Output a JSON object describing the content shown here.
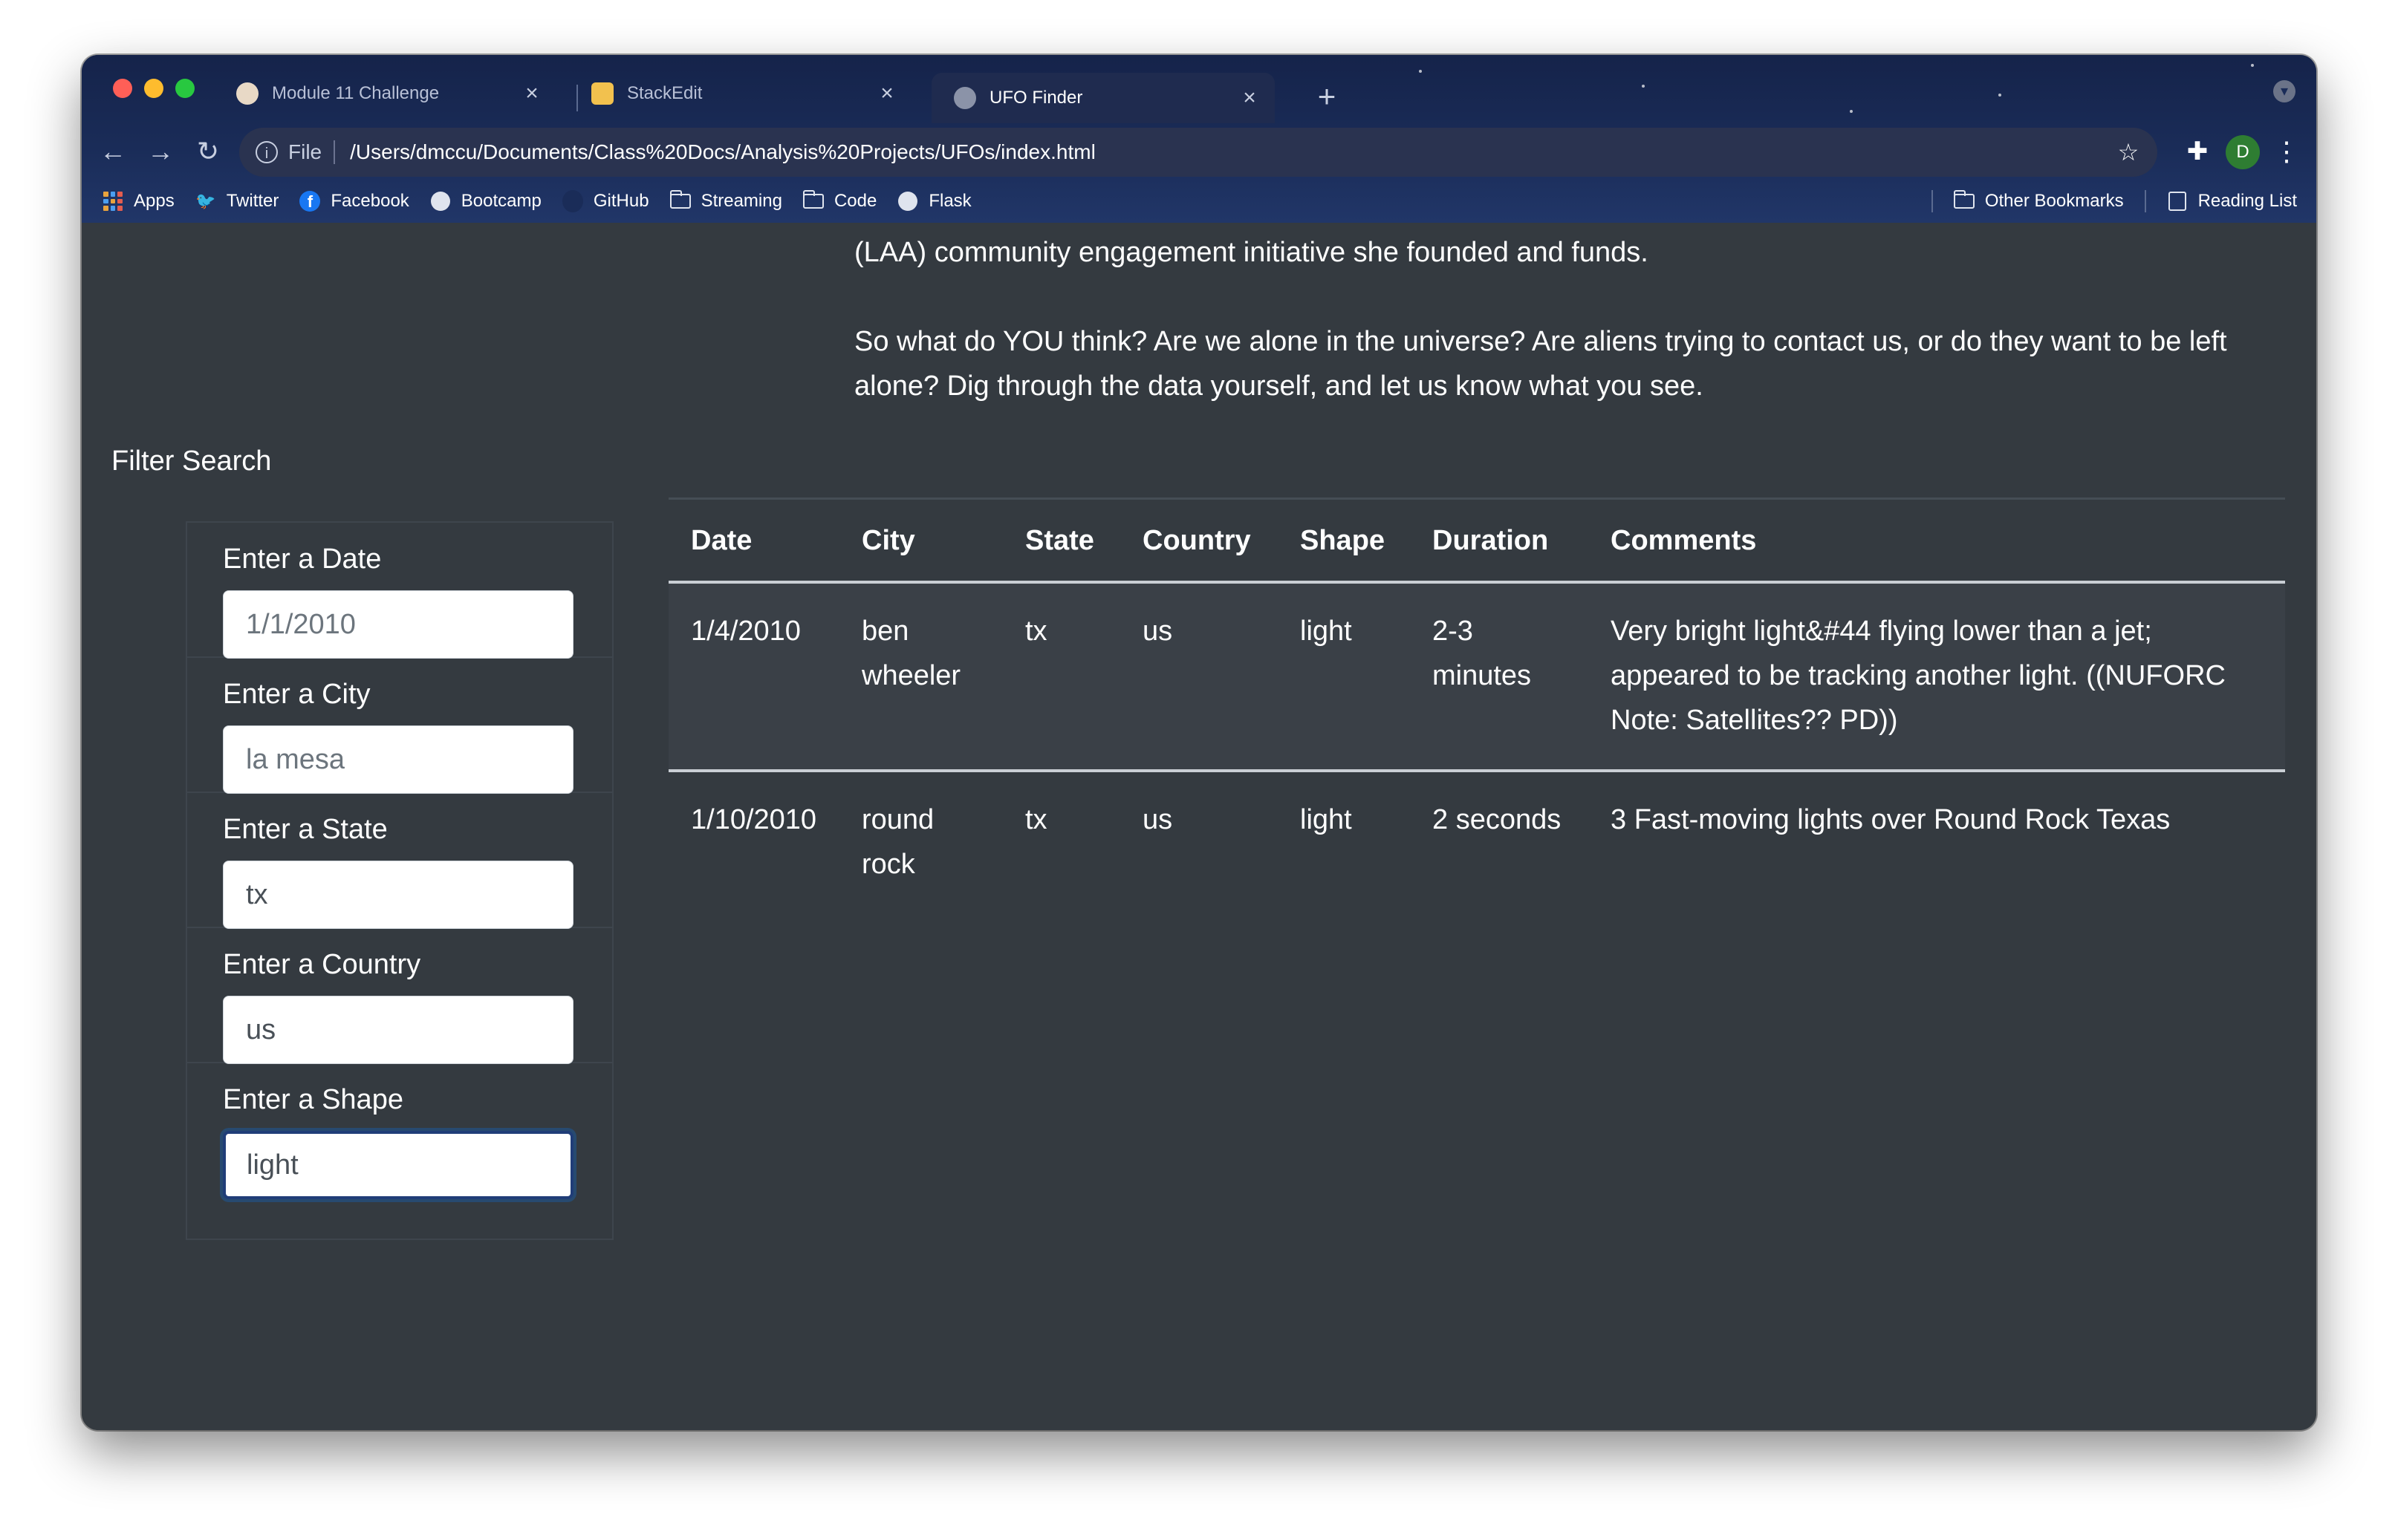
{
  "browser": {
    "tabs": [
      {
        "title": "Module 11 Challenge",
        "active": false
      },
      {
        "title": "StackEdit",
        "active": false
      },
      {
        "title": "UFO Finder",
        "active": true
      }
    ],
    "scheme": "File",
    "url": "/Users/dmccu/Documents/Class%20Docs/Analysis%20Projects/UFOs/index.html",
    "avatar_letter": "D",
    "bookmarks": [
      "Apps",
      "Twitter",
      "Facebook",
      "Bootcamp",
      "GitHub",
      "Streaming",
      "Code",
      "Flask"
    ],
    "bookmarks_right": [
      "Other Bookmarks",
      "Reading List"
    ]
  },
  "intro": {
    "partial_line": "(LAA) community engagement initiative she founded and funds.",
    "paragraph": "So what do YOU think? Are we alone in the universe? Are aliens trying to contact us, or do they want to be left alone? Dig through the data yourself, and let us know what you see."
  },
  "filters": {
    "title": "Filter Search",
    "fields": [
      {
        "label": "Enter a Date",
        "placeholder": "1/1/2010",
        "value": ""
      },
      {
        "label": "Enter a City",
        "placeholder": "la mesa",
        "value": ""
      },
      {
        "label": "Enter a State",
        "placeholder": "",
        "value": "tx"
      },
      {
        "label": "Enter a Country",
        "placeholder": "",
        "value": "us"
      },
      {
        "label": "Enter a Shape",
        "placeholder": "",
        "value": "light"
      }
    ]
  },
  "table": {
    "headers": [
      "Date",
      "City",
      "State",
      "Country",
      "Shape",
      "Duration",
      "Comments"
    ],
    "rows": [
      [
        "1/4/2010",
        "ben wheeler",
        "tx",
        "us",
        "light",
        "2-3 minutes",
        "Very bright light&#44 flying lower than a jet; appeared to be tracking another light. ((NUFORC Note: Satellites?? PD))"
      ],
      [
        "1/10/2010",
        "round rock",
        "tx",
        "us",
        "light",
        "2 seconds",
        "3 Fast-moving lights over Round Rock Texas"
      ]
    ]
  },
  "colors": {
    "page_bg": "#343a40",
    "chrome_bg": "#1a2c58",
    "focus_border": "#203d78"
  }
}
